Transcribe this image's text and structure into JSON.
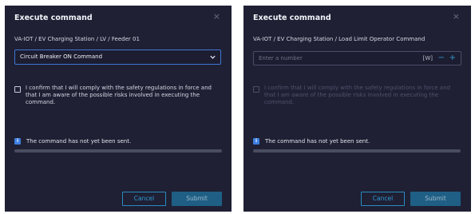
{
  "dialog_a": {
    "title": "Execute command",
    "close_glyph": "×",
    "path": "VA-IOT / EV Charging Station / LV / Feeder 01",
    "command_select": {
      "selected": "Circuit Breaker ON Command",
      "icon": "chevron-down-icon"
    },
    "confirm_text": "I confirm that I will comply with the safety regulations in force and that I am aware of the possible risks involved in executing the command.",
    "confirm_checked": false,
    "status_icon": "i",
    "status_text": "The command has not yet been sent.",
    "progress": 0,
    "cancel_label": "Cancel",
    "submit_label": "Submit"
  },
  "dialog_b": {
    "title": "Execute command",
    "close_glyph": "×",
    "path": "VA-IOT / EV Charging Station / Load Limit Operator Command",
    "number_input": {
      "placeholder": "Enter a number",
      "unit": "[W]",
      "minus": "−",
      "plus": "+"
    },
    "confirm_text": "I confirm that I will comply with the safety regulations in force and that I am aware of the possible risks involved in executing the command.",
    "confirm_checked": false,
    "status_icon": "i",
    "status_text": "The command has not yet been sent.",
    "progress": 0,
    "cancel_label": "Cancel",
    "submit_label": "Submit"
  },
  "colors": {
    "dialog_bg": "#1f2034",
    "accent": "#3d7fe0",
    "button_accent": "#2e9ad3",
    "submit_bg": "#1f5f85"
  }
}
